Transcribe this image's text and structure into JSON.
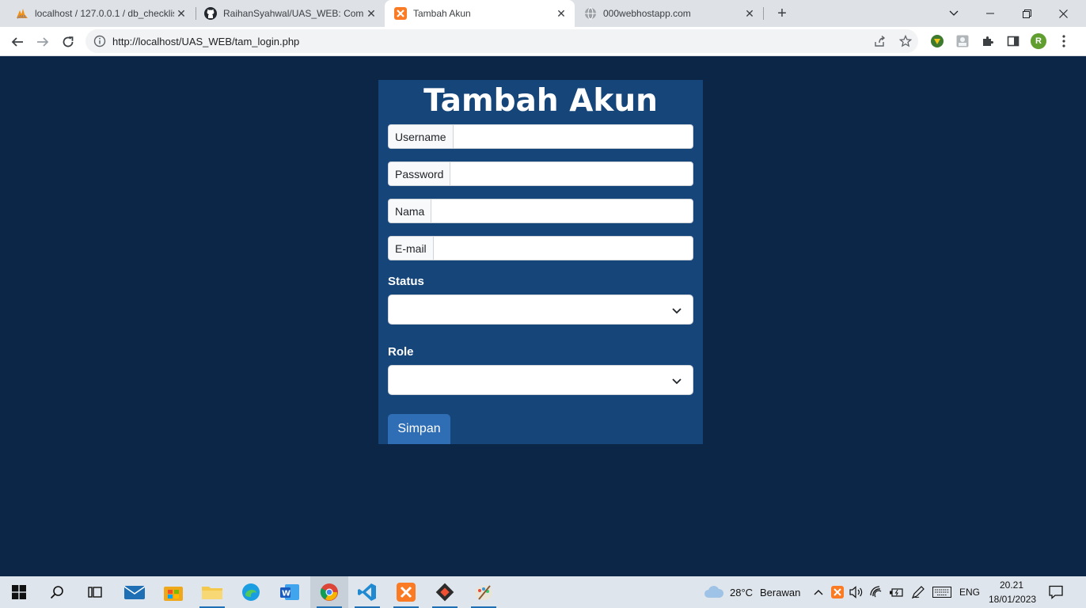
{
  "browser": {
    "tabs": [
      {
        "title": "localhost / 127.0.0.1 / db_checklis",
        "icon": "phpmyadmin-icon",
        "active": false
      },
      {
        "title": "RaihanSyahwal/UAS_WEB: Comin",
        "icon": "github-icon",
        "active": false
      },
      {
        "title": "Tambah Akun",
        "icon": "xampp-icon",
        "active": true
      },
      {
        "title": "000webhostapp.com",
        "icon": "globe-icon",
        "active": false
      }
    ],
    "url": "http://localhost/UAS_WEB/tam_login.php",
    "profile_initial": "R"
  },
  "form": {
    "title": "Tambah Akun",
    "fields": [
      {
        "label": "Username",
        "value": ""
      },
      {
        "label": "Password",
        "value": ""
      },
      {
        "label": "Nama",
        "value": ""
      },
      {
        "label": "E-mail",
        "value": ""
      }
    ],
    "status_label": "Status",
    "status_value": "",
    "role_label": "Role",
    "role_value": "",
    "submit_label": "Simpan"
  },
  "taskbar": {
    "weather_temp": "28°C",
    "weather_desc": "Berawan",
    "language": "ENG",
    "time": "20.21",
    "date": "18/01/2023"
  },
  "colors": {
    "page_bg": "#0b2647",
    "card_bg": "#16457a",
    "button_bg": "#2f6eb5"
  }
}
